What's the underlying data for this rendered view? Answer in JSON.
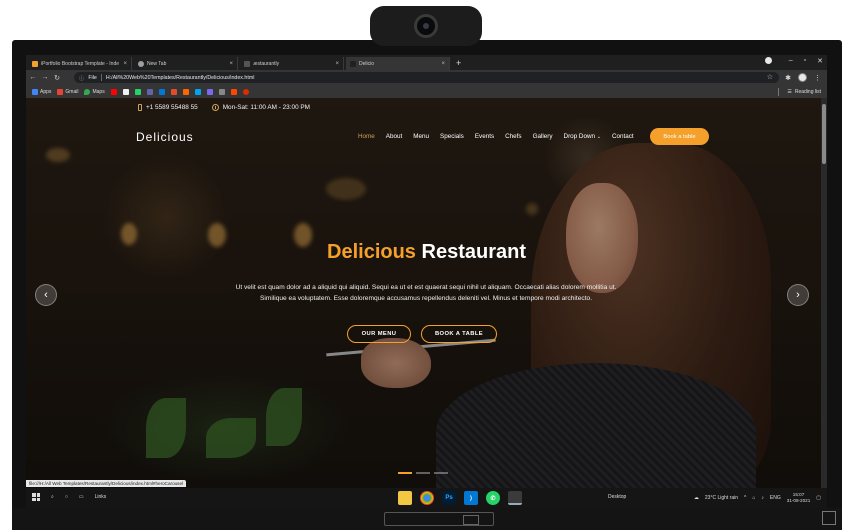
{
  "browser": {
    "tabs": [
      {
        "title": "iPortfolio Bootstrap Template - Inde",
        "active": false,
        "color": "#f4a02a"
      },
      {
        "title": "New Tab",
        "active": false,
        "color": "#9aa0a6"
      },
      {
        "title": "ɹestaurantly",
        "active": false,
        "color": "#555555"
      },
      {
        "title": "Delicio",
        "active": true,
        "color": "#202124"
      }
    ],
    "new_tab": "+",
    "url_prefix": "File",
    "url": "H:/All%20Web%20Templates/Restaurantly/Delicious/index.html",
    "bookmarks": [
      {
        "label": "Apps",
        "color": "#4285f4"
      },
      {
        "label": "Gmail",
        "color": "#ea4335"
      },
      {
        "label": "Maps",
        "color": "#34a853"
      },
      {
        "label": "",
        "color": "#ff0000"
      },
      {
        "label": "",
        "color": "#f0f0f0"
      },
      {
        "label": "",
        "color": "#25d366"
      },
      {
        "label": "",
        "color": "#6264a7"
      },
      {
        "label": "",
        "color": "#0078d4"
      },
      {
        "label": "",
        "color": "#e34c26"
      },
      {
        "label": "",
        "color": "#ff6600"
      },
      {
        "label": "",
        "color": "#00a4ef"
      },
      {
        "label": "",
        "color": "#7b68ee"
      },
      {
        "label": "",
        "color": "#333333"
      },
      {
        "label": "",
        "color": "#ff4500"
      },
      {
        "label": "",
        "color": "#dd2c00"
      }
    ],
    "reading_list": "Reading list",
    "status_url": "file:///H:/All Web Templates/Restaurantly/Delicious/index.html#heroCarousel"
  },
  "site": {
    "phone": "+1 5589 55488 55",
    "hours": "Mon-Sat: 11:00 AM - 23:00 PM",
    "logo": "Delicious",
    "nav": [
      {
        "label": "Home",
        "active": true
      },
      {
        "label": "About",
        "active": false
      },
      {
        "label": "Menu",
        "active": false
      },
      {
        "label": "Specials",
        "active": false
      },
      {
        "label": "Events",
        "active": false
      },
      {
        "label": "Chefs",
        "active": false
      },
      {
        "label": "Gallery",
        "active": false
      },
      {
        "label": "Drop Down",
        "active": false
      },
      {
        "label": "Contact",
        "active": false
      }
    ],
    "book_button": "Book a table",
    "hero": {
      "title_accent": "Delicious",
      "title_rest": "Restaurant",
      "description": "Ut velit est quam dolor ad a aliquid qui aliquid. Sequi ea ut et est quaerat sequi nihil ut aliquam. Occaecati alias dolorem mollitia ut. Similique ea voluptatem. Esse doloremque accusamus repellendus deleniti vel. Minus et tempore modi architecto.",
      "cta_menu": "OUR MENU",
      "cta_book": "BOOK A TABLE"
    },
    "accent_color": "#f4a02a"
  },
  "taskbar": {
    "links": "Links",
    "desktop": "Desktop",
    "weather": "23°C Light rain",
    "language": "ENG",
    "time": "15:07",
    "date": "31-08-2021"
  }
}
